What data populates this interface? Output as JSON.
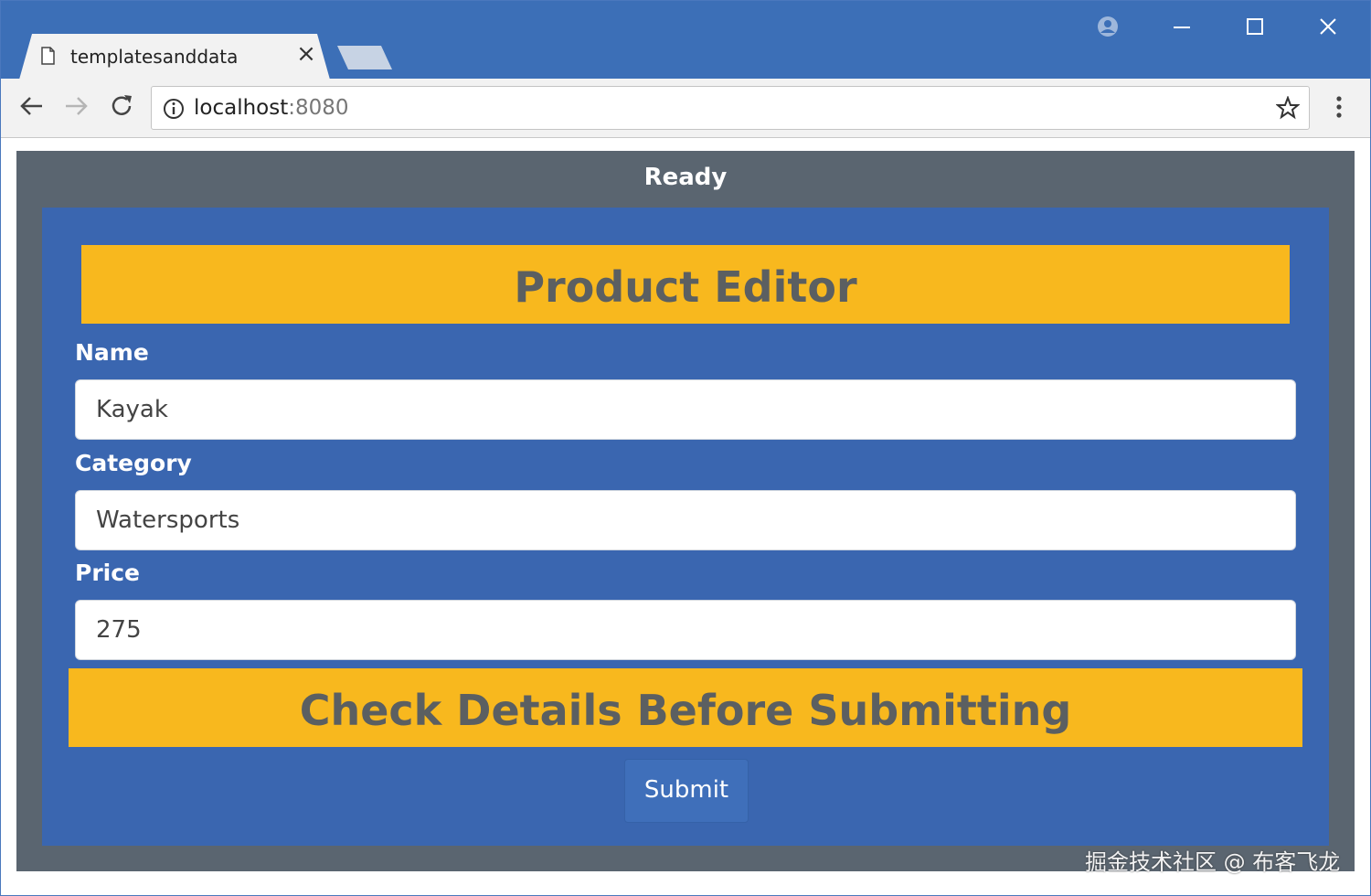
{
  "browser": {
    "tab_title": "templatesanddata",
    "address_host": "localhost",
    "address_port": ":8080"
  },
  "page": {
    "status": "Ready",
    "header_banner": "Product Editor",
    "footer_banner": "Check Details Before Submitting",
    "fields": [
      {
        "label": "Name",
        "value": "Kayak"
      },
      {
        "label": "Category",
        "value": "Watersports"
      },
      {
        "label": "Price",
        "value": "275"
      }
    ],
    "submit_label": "Submit"
  },
  "watermark": "掘金技术社区 @ 布客飞龙",
  "colors": {
    "titlebar": "#3c6fb7",
    "panel": "#3a66b0",
    "outer": "#5a6570",
    "banner": "#f8b81e"
  }
}
